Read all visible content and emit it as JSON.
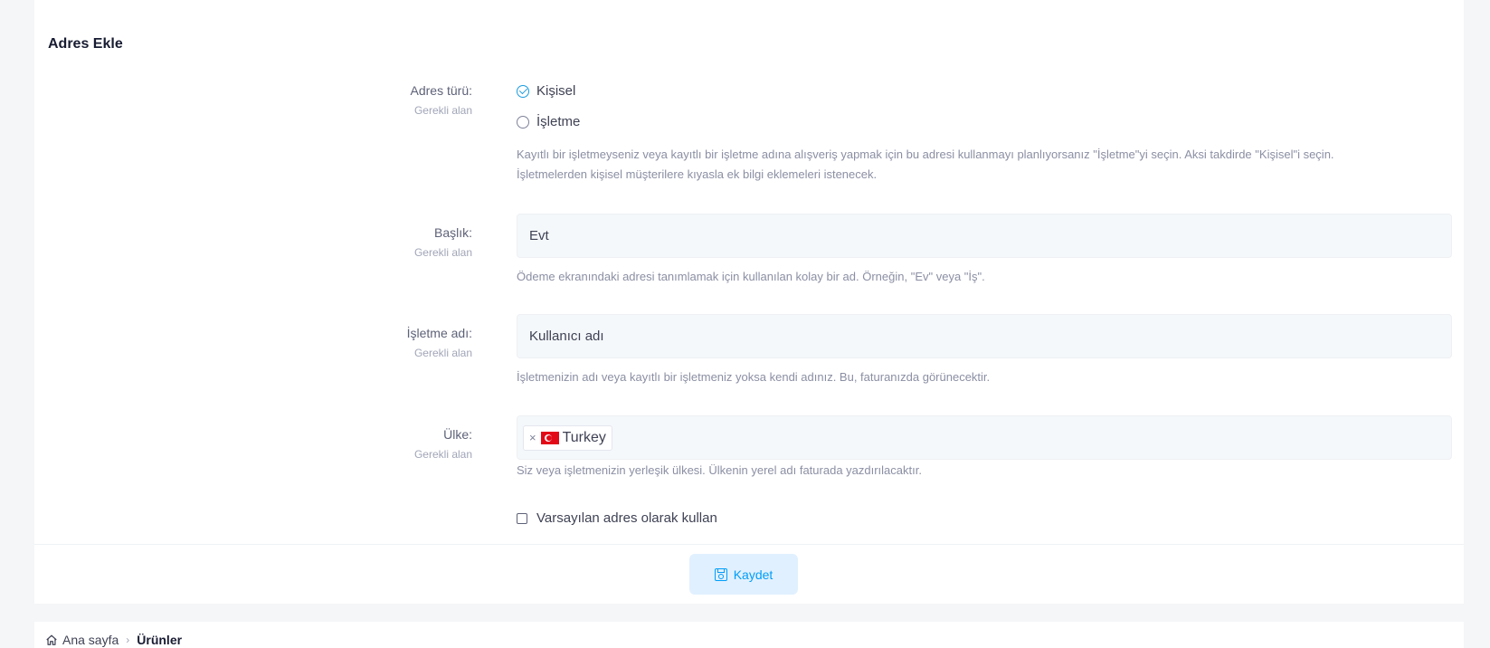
{
  "card": {
    "title": "Adres Ekle"
  },
  "address_type": {
    "label": "Adres türü:",
    "required": "Gerekli alan",
    "options": [
      {
        "label": "Kişisel",
        "checked": true
      },
      {
        "label": "İşletme",
        "checked": false
      }
    ],
    "help_line1": "Kayıtlı bir işletmeyseniz veya kayıtlı bir işletme adına alışveriş yapmak için bu adresi kullanmayı planlıyorsanız \"İşletme\"yi seçin. Aksi takdirde \"Kişisel\"i seçin.",
    "help_line2": "İşletmelerden kişisel müşterilere kıyasla ek bilgi eklemeleri istenecek."
  },
  "title_field": {
    "label": "Başlık:",
    "required": "Gerekli alan",
    "value": "Evt",
    "help": "Ödeme ekranındaki adresi tanımlamak için kullanılan kolay bir ad. Örneğin, \"Ev\" veya \"İş\"."
  },
  "business_name_field": {
    "label": "İşletme adı:",
    "required": "Gerekli alan",
    "value": "Kullanıcı adı",
    "help": "İşletmenizin adı veya kayıtlı bir işletmeniz yoksa kendi adınız. Bu, faturanızda görünecektir."
  },
  "country_field": {
    "label": "Ülke:",
    "required": "Gerekli alan",
    "selected": "Turkey",
    "remove_symbol": "×",
    "help": "Siz veya işletmenizin yerleşik ülkesi. Ülkenin yerel adı faturada yazdırılacaktır."
  },
  "default_checkbox": {
    "label": "Varsayılan adres olarak kullan",
    "checked": false
  },
  "save_button": {
    "label": "Kaydet",
    "icon": "save-icon"
  },
  "breadcrumb": {
    "home": "Ana sayfa",
    "separator": "›",
    "current": "Ürünler"
  },
  "colors": {
    "accent": "#009ef7",
    "accent_bg": "#e1f0ff",
    "check": "#1a9be0"
  }
}
